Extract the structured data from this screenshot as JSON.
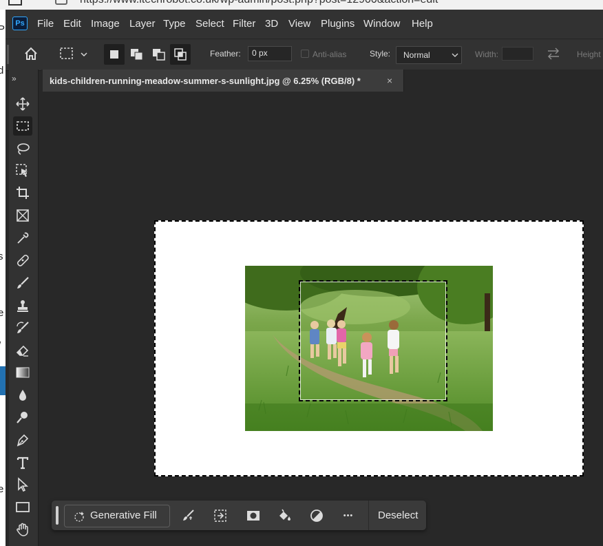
{
  "browser": {
    "url_fragment": "https://www.itechrobot.co.uk/wp-admin/post.php?post=12900&action=edit"
  },
  "app": {
    "logo": "Ps",
    "menu": [
      "File",
      "Edit",
      "Image",
      "Layer",
      "Type",
      "Select",
      "Filter",
      "3D",
      "View",
      "Plugins",
      "Window",
      "Help"
    ]
  },
  "options": {
    "feather_label": "Feather:",
    "feather_value": "0 px",
    "antialias_label": "Anti-alias",
    "style_label": "Style:",
    "style_value": "Normal",
    "width_label": "Width:",
    "width_value": "",
    "height_label": "Height"
  },
  "document": {
    "tab_title": "kids-children-running-meadow-summer-s-sunlight.jpg @ 6.25% (RGB/8) *",
    "close_glyph": "×"
  },
  "toolbar": {
    "collapse_glyph": "»",
    "tools": [
      "move",
      "rectangular-marquee",
      "lasso",
      "object-selection",
      "crop",
      "frame",
      "eyedropper",
      "spot-healing-brush",
      "brush",
      "clone-stamp",
      "history-brush",
      "eraser",
      "gradient",
      "blur",
      "dodge",
      "pen",
      "type",
      "path-selection",
      "rectangle",
      "hand"
    ]
  },
  "taskbar": {
    "generative_fill": "Generative Fill",
    "more_glyph": "•••",
    "deselect": "Deselect"
  },
  "colors": {
    "app_bg": "#282828",
    "panel": "#323232",
    "accent": "#31a8ff"
  }
}
